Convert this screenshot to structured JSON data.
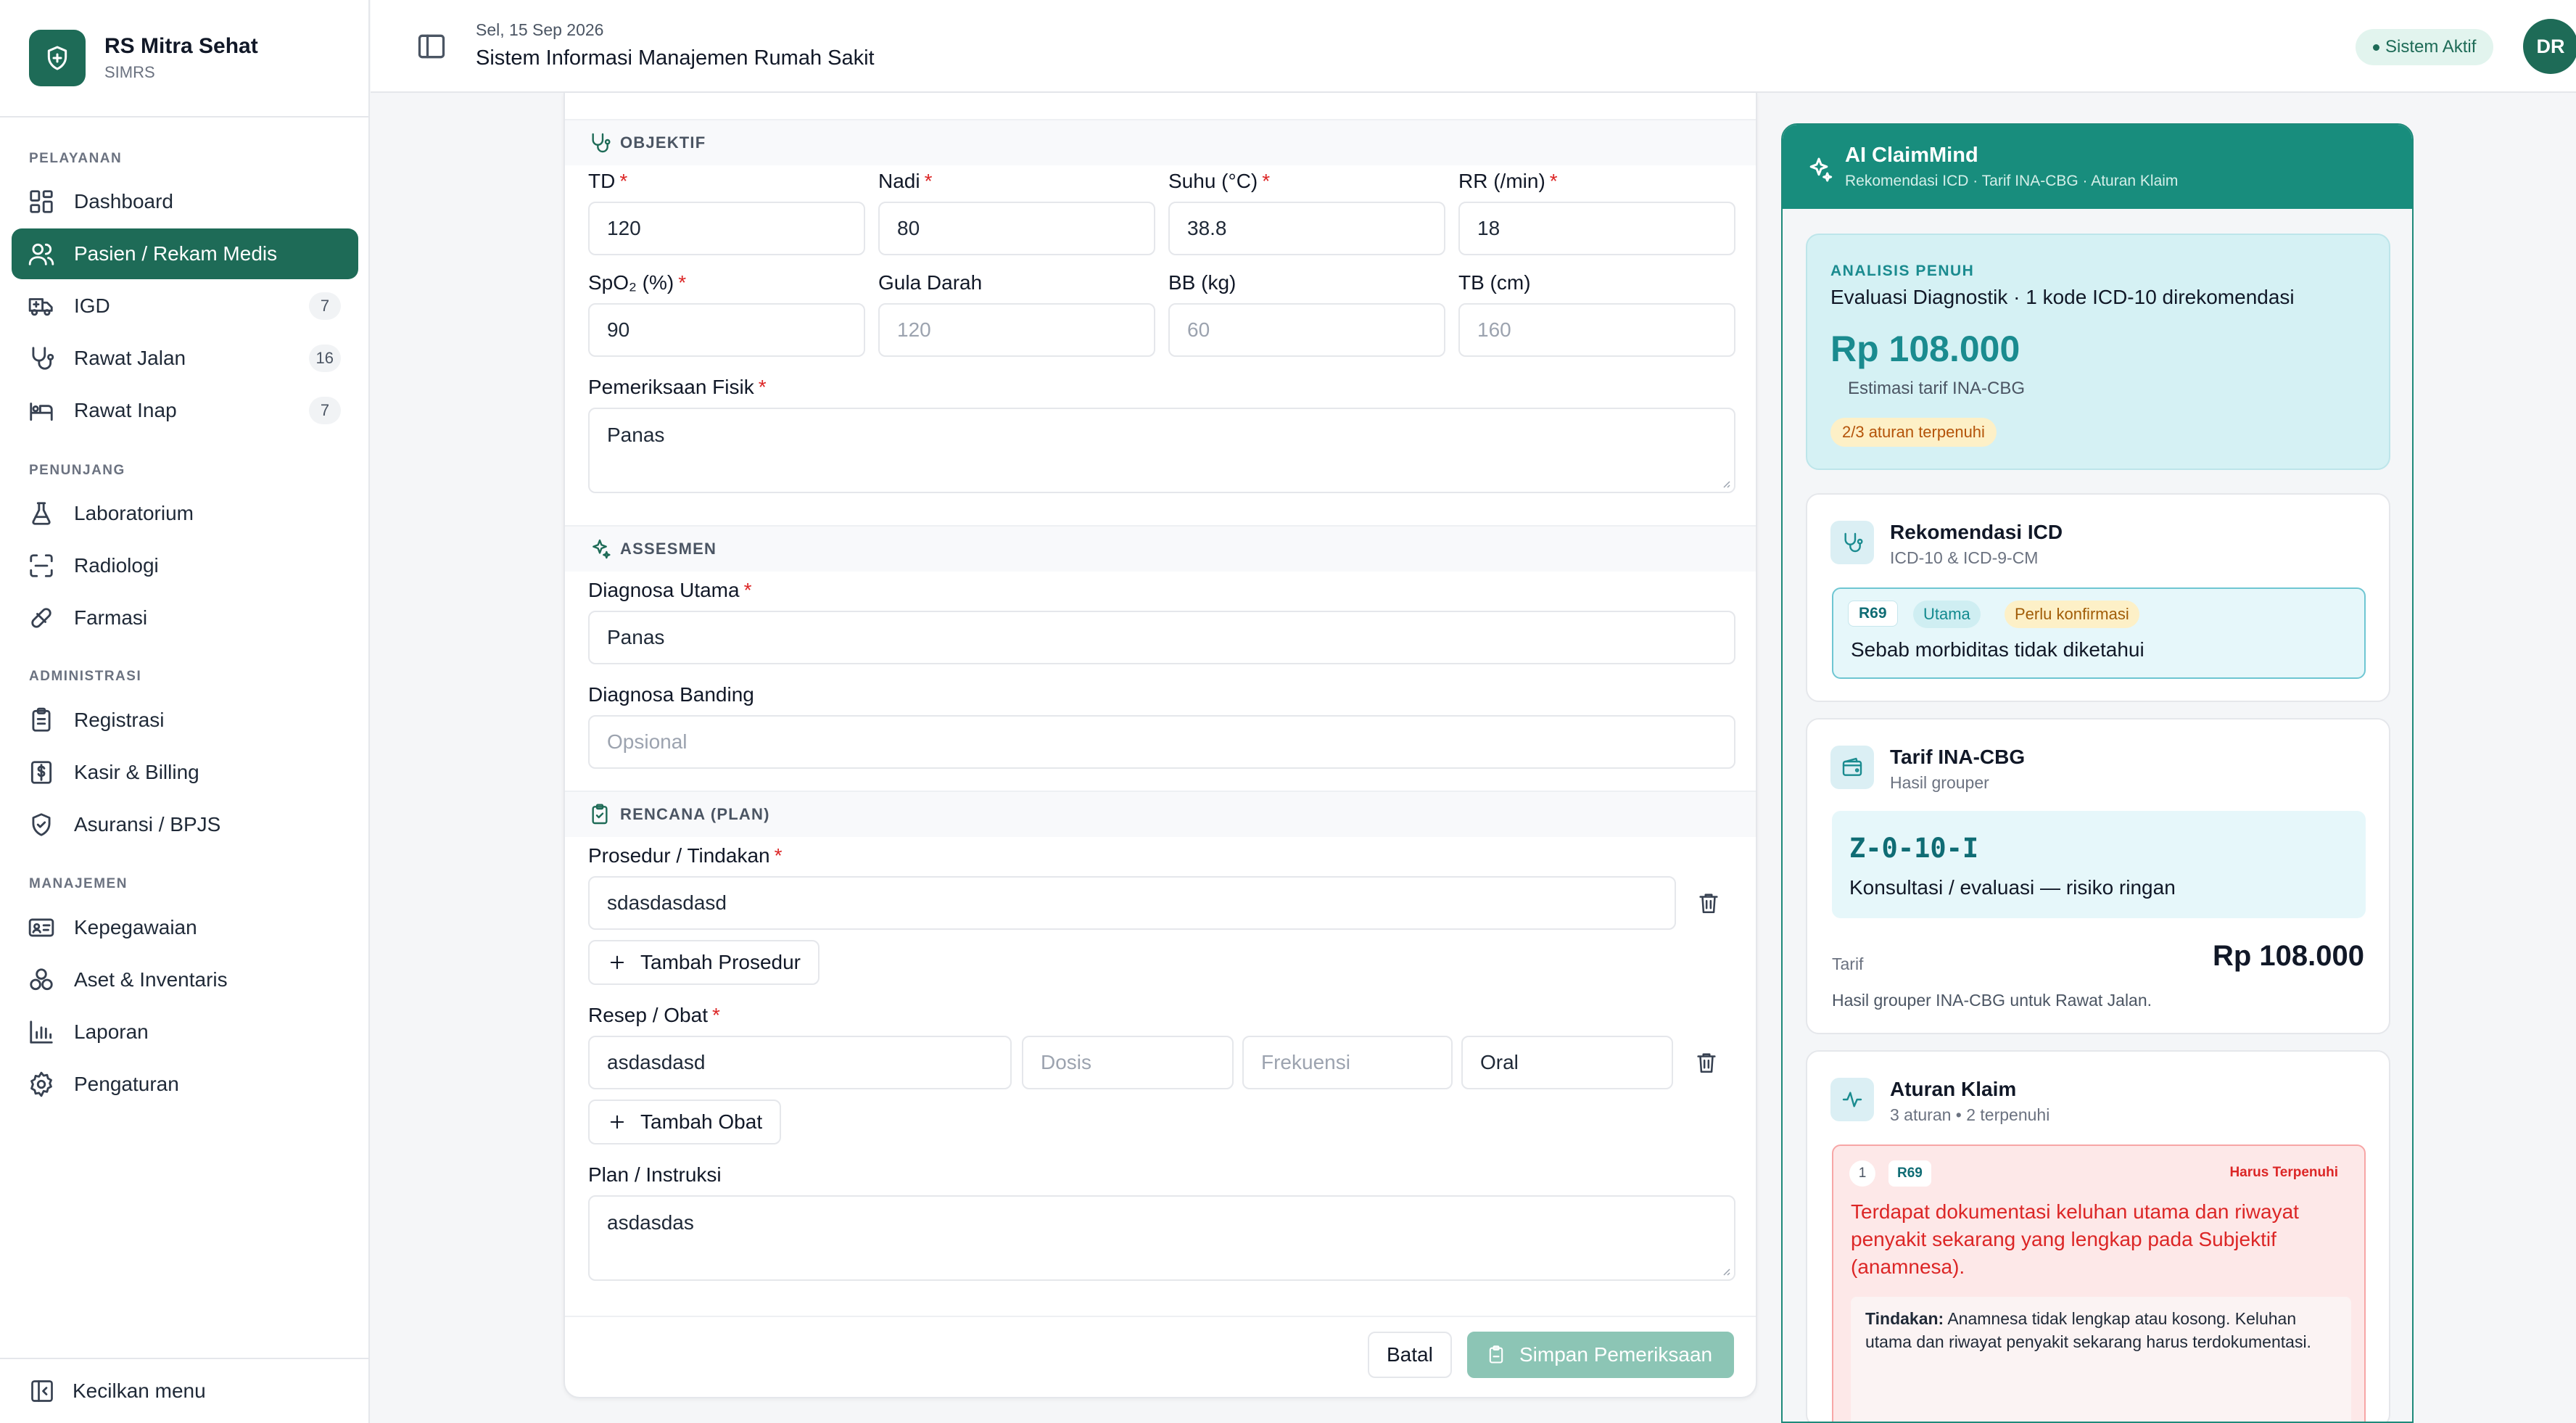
{
  "brand": {
    "name": "RS Mitra Sehat",
    "sub": "SIMRS"
  },
  "sidebar": {
    "sections": {
      "pelayanan": "PELAYANAN",
      "penunjang": "PENUNJANG",
      "administrasi": "ADMINISTRASI",
      "manajemen": "MANAJEMEN"
    },
    "items": [
      {
        "label": "Dashboard",
        "icon": "grid-icon"
      },
      {
        "label": "Pasien / Rekam Medis",
        "icon": "users-icon",
        "active": true
      },
      {
        "label": "IGD",
        "icon": "ambulance-icon",
        "count": "7"
      },
      {
        "label": "Rawat Jalan",
        "icon": "stethoscope-icon",
        "count": "16"
      },
      {
        "label": "Rawat Inap",
        "icon": "bed-icon",
        "count": "7"
      },
      {
        "label": "Laboratorium",
        "icon": "flask-icon"
      },
      {
        "label": "Radiologi",
        "icon": "scan-icon"
      },
      {
        "label": "Farmasi",
        "icon": "pill-icon"
      },
      {
        "label": "Registrasi",
        "icon": "clipboard-icon"
      },
      {
        "label": "Kasir & Billing",
        "icon": "receipt-icon"
      },
      {
        "label": "Asuransi / BPJS",
        "icon": "shield-check-icon"
      },
      {
        "label": "Kepegawaian",
        "icon": "id-card-icon"
      },
      {
        "label": "Aset & Inventaris",
        "icon": "boxes-icon"
      },
      {
        "label": "Laporan",
        "icon": "bar-chart-icon"
      },
      {
        "label": "Pengaturan",
        "icon": "gear-icon"
      }
    ],
    "collapse_label": "Kecilkan menu"
  },
  "header": {
    "date": "Sel, 15 Sep 2026",
    "title": "Sistem Informasi Manajemen Rumah Sakit",
    "status": "Sistem Aktif",
    "avatar": "DR"
  },
  "form": {
    "objektif": {
      "title": "OBJEKTIF",
      "fields": [
        {
          "label": "TD",
          "required": true,
          "value": "120",
          "placeholder": ""
        },
        {
          "label": "Nadi",
          "required": true,
          "value": "80",
          "placeholder": ""
        },
        {
          "label": "Suhu (°C)",
          "required": true,
          "value": "38.8",
          "placeholder": ""
        },
        {
          "label": "RR (/min)",
          "required": true,
          "value": "18",
          "placeholder": ""
        },
        {
          "label": "SpO₂ (%)",
          "required": true,
          "value": "90",
          "placeholder": ""
        },
        {
          "label": "Gula Darah",
          "required": false,
          "value": "",
          "placeholder": "120"
        },
        {
          "label": "BB (kg)",
          "required": false,
          "value": "",
          "placeholder": "60"
        },
        {
          "label": "TB (cm)",
          "required": false,
          "value": "",
          "placeholder": "160"
        }
      ],
      "fisik_label": "Pemeriksaan Fisik",
      "fisik_value": "Panas"
    },
    "assesmen": {
      "title": "ASSESMEN",
      "utama_label": "Diagnosa Utama",
      "utama_value": "Panas",
      "banding_label": "Diagnosa Banding",
      "banding_placeholder": "Opsional"
    },
    "plan": {
      "title": "RENCANA (PLAN)",
      "prosedur_label": "Prosedur / Tindakan",
      "prosedur_value": "sdasdasdasd",
      "add_prosedur": "Tambah Prosedur",
      "resep_label": "Resep / Obat",
      "obat_value": "asdasdasd",
      "dosis_placeholder": "Dosis",
      "frekuensi_placeholder": "Frekuensi",
      "rute_value": "Oral",
      "add_obat": "Tambah Obat",
      "instruksi_label": "Plan / Instruksi",
      "instruksi_value": "asdasdas"
    },
    "cancel": "Batal",
    "save": "Simpan Pemeriksaan"
  },
  "ai": {
    "title": "AI ClaimMind",
    "subtitle": "Rekomendasi ICD · Tarif INA-CBG · Aturan Klaim",
    "summary": {
      "tag": "ANALISIS PENUH",
      "text": "Evaluasi Diagnostik · 1 kode ICD-10 direkomendasi",
      "price": "Rp 108.000",
      "estimate": "Estimasi tarif INA-CBG",
      "rules": "2/3 aturan terpenuhi"
    },
    "icd": {
      "title": "Rekomendasi ICD",
      "subtitle": "ICD-10 & ICD-9-CM",
      "code": "R69",
      "type": "Utama",
      "confirm": "Perlu konfirmasi",
      "name": "Sebab morbiditas tidak diketahui"
    },
    "tarif": {
      "title": "Tarif INA-CBG",
      "subtitle": "Hasil grouper",
      "group_code": "Z-0-10-I",
      "group_desc": "Konsultasi / evaluasi — risiko ringan",
      "label": "Tarif",
      "value": "Rp 108.000",
      "note": "Hasil grouper INA-CBG untuk Rawat Jalan."
    },
    "rules": {
      "title": "Aturan Klaim",
      "subtitle": "3 aturan • 2 terpenuhi",
      "no": "1",
      "code": "R69",
      "level": "Harus Terpenuhi",
      "text": "Terdapat dokumentasi keluhan utama dan riwayat penyakit sekarang yang lengkap pada Subjektif (anamnesa).",
      "action_label": "Tindakan:",
      "action": "Anamnesa tidak lengkap atau kosong. Keluhan utama dan riwayat penyakit sekarang harus terdokumentasi."
    }
  }
}
